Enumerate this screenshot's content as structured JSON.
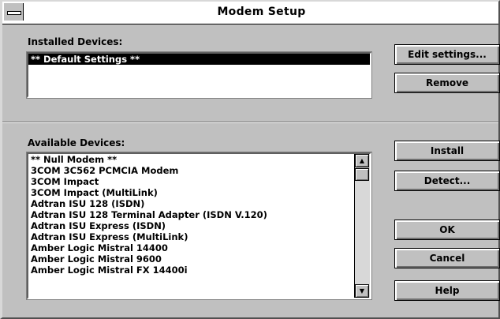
{
  "window": {
    "title": "Modem Setup"
  },
  "installed": {
    "label": "Installed Devices:",
    "items": [
      "** Default Settings **"
    ]
  },
  "available": {
    "label": "Available Devices:",
    "items": [
      "** Null Modem **",
      "3COM 3C562 PCMCIA Modem",
      "3COM Impact",
      "3COM Impact (MultiLink)",
      "Adtran ISU 128 (ISDN)",
      "Adtran ISU 128 Terminal Adapter (ISDN V.120)",
      "Adtran ISU Express (ISDN)",
      "Adtran ISU Express (MultiLink)",
      "Amber Logic Mistral 14400",
      "Amber Logic Mistral 9600",
      "Amber Logic Mistral FX 14400i"
    ]
  },
  "buttons": {
    "edit_settings": "Edit settings...",
    "remove": "Remove",
    "install": "Install",
    "detect": "Detect...",
    "ok": "OK",
    "cancel": "Cancel",
    "help": "Help"
  },
  "icons": {
    "system_menu": "system-menu-icon",
    "scroll_up": "up-arrow-icon",
    "scroll_down": "down-arrow-icon"
  }
}
